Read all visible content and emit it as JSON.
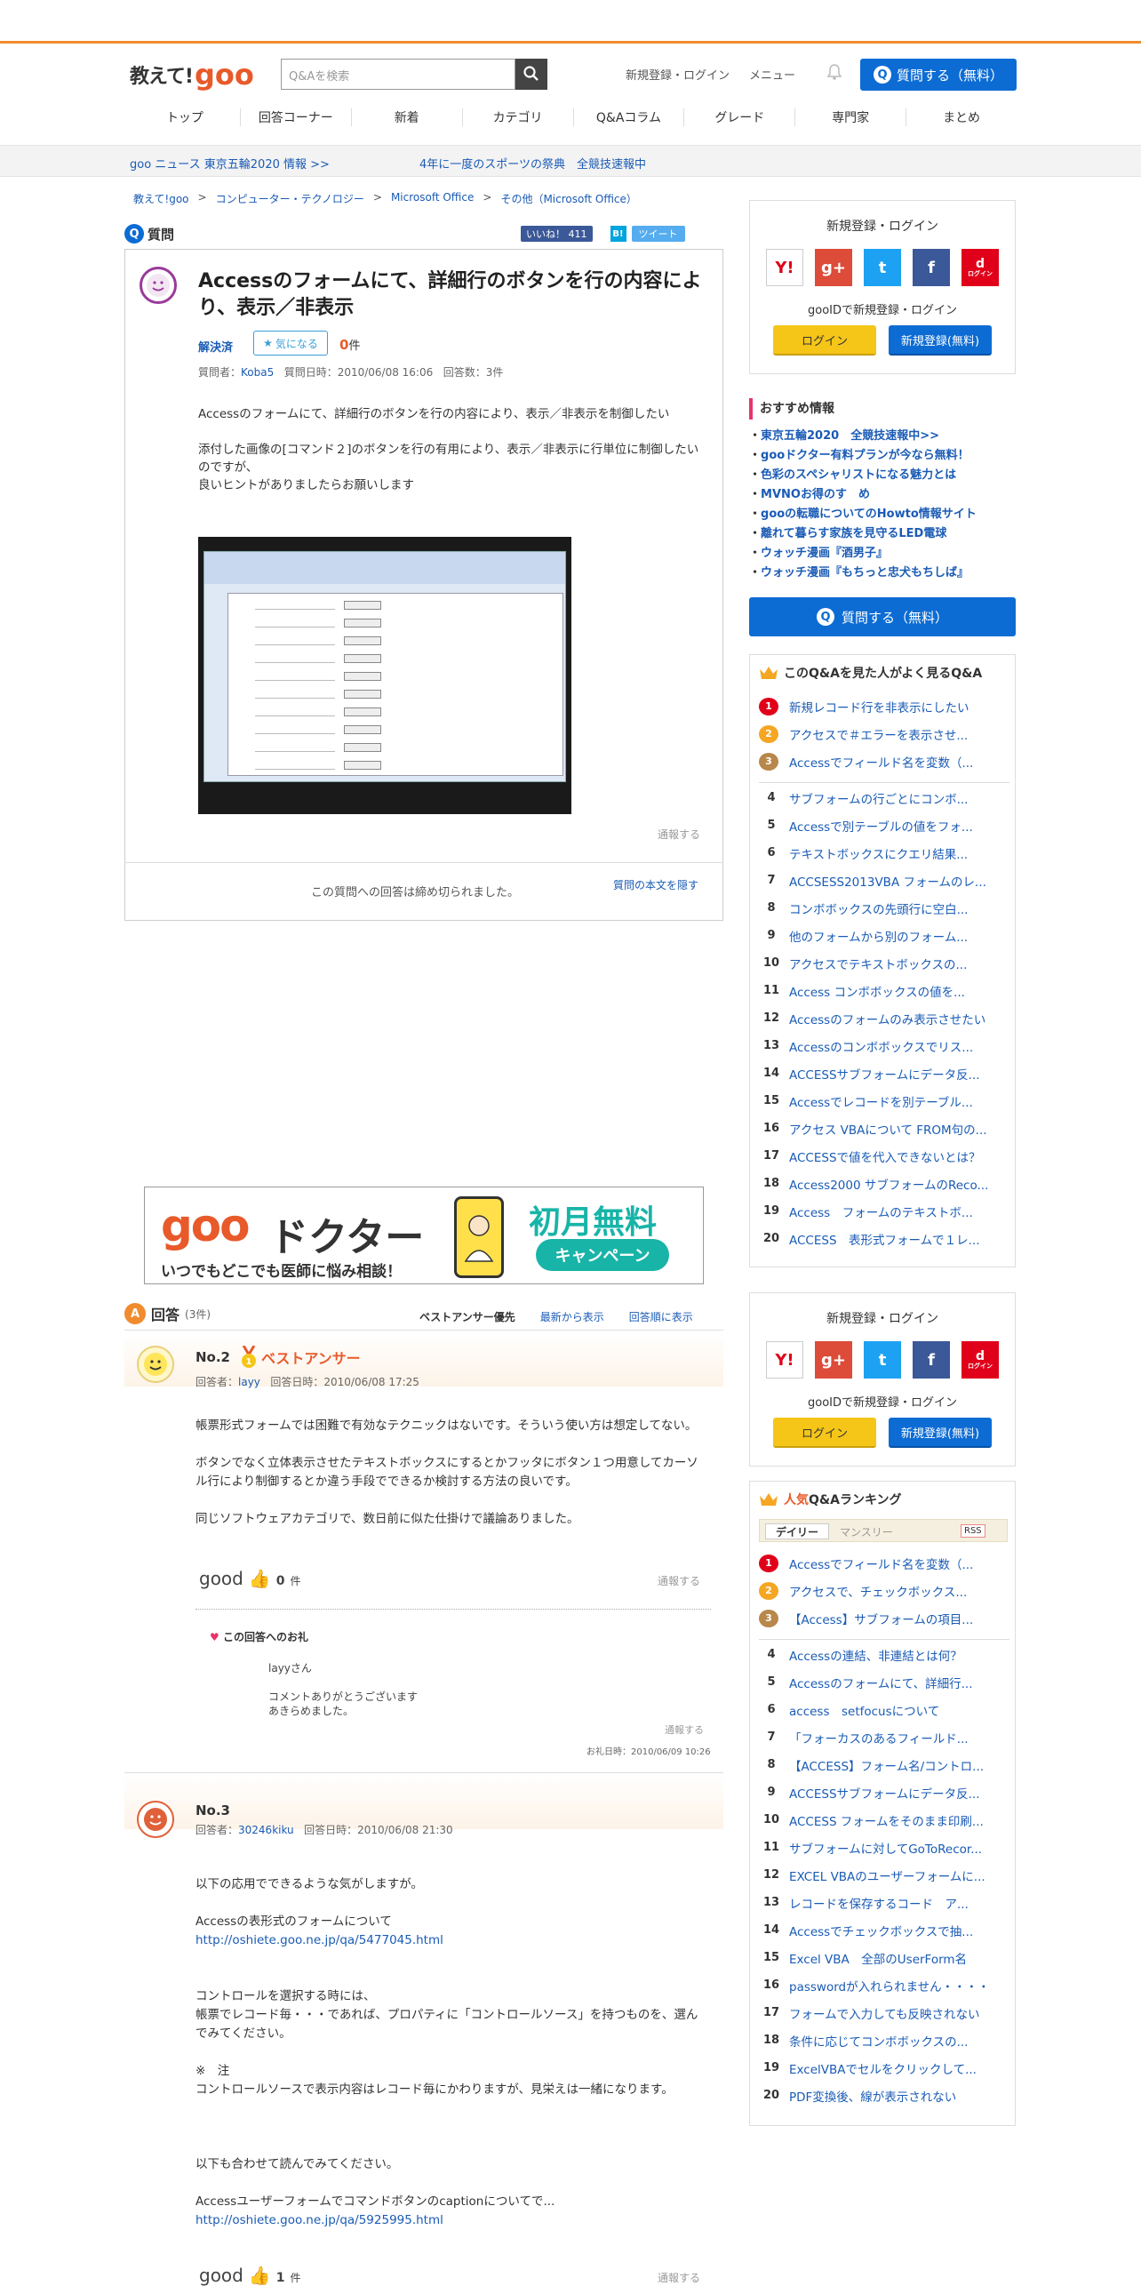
{
  "header": {
    "logo_main": "教えて!",
    "logo_brand": "goo",
    "search_placeholder": "Q&Aを検索",
    "link_login": "新規登録・ログイン",
    "link_menu": "メニュー",
    "ask_button": "質問する（無料）"
  },
  "nav": [
    "トップ",
    "回答コーナー",
    "新着",
    "カテゴリ",
    "Q&Aコラム",
    "グレード",
    "専門家",
    "まとめ"
  ],
  "newsbar": {
    "item1": "goo ニュース 東京五輪2020 情報 >>",
    "item2": "4年に一度のスポーツの祭典　全競技速報中"
  },
  "breadcrumb": [
    "教えて!goo",
    "コンピューター・テクノロジー",
    "Microsoft Office",
    "その他（Microsoft Office）"
  ],
  "question": {
    "section_label": "質問",
    "like_label": "いいね！ 411",
    "tweet_label": "ツイート",
    "hatena_label": "B!",
    "title": "Accessのフォームにて、詳細行のボタンを行の内容により、表示／非表示",
    "resolved": "解決済",
    "watch_label": "気になる",
    "watch_count": "0",
    "watch_unit": "件",
    "meta_author_label": "質問者：",
    "meta_author": "Koba5",
    "meta_date": "質問日時：2010/06/08 16:06",
    "meta_answers": "回答数：3件",
    "body_p1": "Accessのフォームにて、詳細行のボタンを行の内容により、表示／非表示を制御したい",
    "body_p2_l1": "添付した画像の[コマンド２]のボタンを行の有用により、表示／非表示に行単位に制御したいのですが、",
    "body_p2_l2": "良いヒントがありましたらお願いします",
    "report": "通報する",
    "closed": "この質問への回答は締め切られました。",
    "hide": "質問の本文を隠す"
  },
  "ad": {
    "brand": "goo",
    "word": "ドクター",
    "sub": "いつでもどこでも医師に悩み相談！",
    "promo": "初月無料",
    "campaign": "キャンペーン"
  },
  "answers": {
    "label": "回答",
    "count": "(3件)",
    "sort_best": "ベストアンサー優先",
    "sort_new": "最新から表示",
    "sort_old": "回答順に表示",
    "a2": {
      "no": "No.2",
      "best": "ベストアンサー",
      "meta_author_label": "回答者：",
      "author": "layy",
      "date": "回答日時：2010/06/08 17:25",
      "p1": "帳票形式フォームでは困難で有効なテクニックはないです。そういう使い方は想定してない。",
      "p2": "ボタンでなく立体表示させたテキストボックスにするとかフッタにボタン１つ用意してカーソル行により制御するとか違う手段でできるか検討する方法の良いです。",
      "p3": "同じソフトウェアカテゴリで、数日前に似た仕掛けで議論ありました。",
      "good": "good",
      "good_count": "0",
      "good_unit": "件",
      "report": "通報する",
      "thanks_label": "この回答へのお礼",
      "thanks_l1": "layyさん",
      "thanks_l2": "コメントありがとうございます",
      "thanks_l3": "あきらめました。",
      "thanks_report": "通報する",
      "thanks_date": "お礼日時：2010/06/09 10:26"
    },
    "a3": {
      "no": "No.3",
      "meta_author_label": "回答者：",
      "author": "30246kiku",
      "date": "回答日時：2010/06/08 21:30",
      "p1": "以下の応用でできるような気がしますが。",
      "p2": "Accessの表形式のフォームについて",
      "link1": "http://oshiete.goo.ne.jp/qa/5477045.html",
      "p3_l1": "コントロールを選択する時には、",
      "p3_l2": "帳票でレコード毎・・・であれば、プロパティに「コントロールソース」を持つものを、選んでみてください。",
      "p4_l1": "※　注",
      "p4_l2": "コントロールソースで表示内容はレコード毎にかわりますが、見栄えは一緒になります。",
      "p5": "以下も合わせて読んでみてください。",
      "p6": "Accessユーザーフォームでコマンドボタンのcaptionについてで...",
      "link2": "http://oshiete.goo.ne.jp/qa/5925995.html",
      "good": "good",
      "good_count": "1",
      "good_unit": "件",
      "report": "通報する"
    }
  },
  "sidebar": {
    "login_title": "新規登録・ログイン",
    "social_icons": [
      "yahoo-icon",
      "google-plus-icon",
      "twitter-icon",
      "facebook-icon",
      "docomo-icon"
    ],
    "social_labels": [
      "Y!",
      "g+",
      "t",
      "f",
      "d"
    ],
    "docomo_sub": "ログイン",
    "gooid": "gooIDで新規登録・ログイン",
    "login_btn": "ログイン",
    "register_btn": "新規登録(無料)",
    "rec_title": "おすすめ情報",
    "rec_items": [
      "東京五輪2020　全競技速報中>>",
      "gooドクター有料プランが今なら無料！",
      "色彩のスペシャリストになる魅力とは",
      "MVNOお得のす　め",
      "gooの転職についてのHowto情報サイト",
      "離れて暮らす家族を見守るLED電球",
      "ウォッチ漫画『酒男子』",
      "ウォッチ漫画『もちっと忠犬もちしば』"
    ],
    "ask_button": "質問する（無料）",
    "related_title": "このQ&Aを見た人がよく見るQ&A",
    "related": [
      "新規レコード行を非表示にしたい",
      "アクセスで＃エラーを表示させ...",
      "Accessでフィールド名を変数（...",
      "サブフォームの行ごとにコンボ...",
      "Accessで別テーブルの値をフォ...",
      "テキストボックスにクエリ結果...",
      "ACCSESS2013VBA フォームのレ...",
      "コンボボックスの先頭行に空白...",
      "他のフォームから別のフォーム...",
      "アクセスでテキストボックスの...",
      "Access コンボボックスの値を...",
      "Accessのフォームのみ表示させたい",
      "Accessのコンボボックスでリス...",
      "ACCESSサブフォームにデータ反...",
      "Accessでレコードを別テーブル...",
      "アクセス VBAについて FROM句の...",
      "ACCESSで値を代入できないとは？",
      "Access2000 サブフォームのReco...",
      "Access　フォームのテキストボ...",
      "ACCESS　表形式フォームで１レ..."
    ],
    "ranking_title_accent": "人気",
    "ranking_title": "Q&Aランキング",
    "tab_daily": "デイリー",
    "tab_monthly": "マンスリー",
    "rss": "RSS",
    "ranking": [
      "Accessでフィールド名を変数（...",
      "アクセスで、チェックボックス...",
      "【Access】サブフォームの項目...",
      "Accessの連結、非連結とは何？",
      "Accessのフォームにて、詳細行...",
      "access　setfocusについて",
      "「フォーカスのあるフィールド...",
      "【ACCESS】フォーム名/コントロ...",
      "ACCESSサブフォームにデータ反...",
      "ACCESS フォームをそのまま印刷...",
      "サブフォームに対してGoToRecor...",
      "EXCEL VBAのユーザーフォームに...",
      "レコードを保存するコード　ア...",
      "Accessでチェックボックスで抽...",
      "Excel VBA　全部のUserForm名",
      "passwordが入れられません・・・・",
      "フォームで入力しても反映されない",
      "条件に応じてコンボボックスの...",
      "ExcelVBAでセルをクリックして...",
      "PDF変換後、線が表示されない"
    ]
  }
}
